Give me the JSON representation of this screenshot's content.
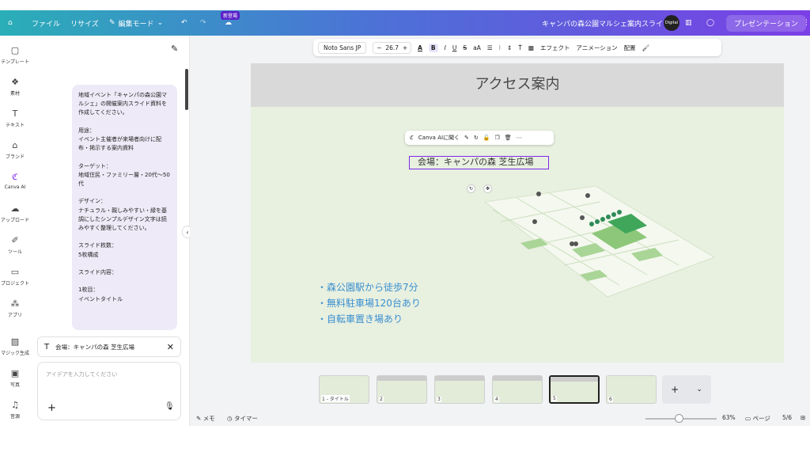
{
  "topbar": {
    "file": "ファイル",
    "resize": "リサイズ",
    "edit_mode": "編集モード",
    "new_badge": "新登場",
    "doc_title": "キャンパの森公園マルシェ案内スライド",
    "present": "プレゼンテーション"
  },
  "rail": [
    {
      "icon": "template-icon",
      "label": "テンプレート"
    },
    {
      "icon": "elements-icon",
      "label": "素材"
    },
    {
      "icon": "text-icon",
      "label": "テキスト"
    },
    {
      "icon": "brand-icon",
      "label": "ブランド"
    },
    {
      "icon": "canva-ai-icon",
      "label": "Canva AI"
    },
    {
      "icon": "upload-icon",
      "label": "アップロード"
    },
    {
      "icon": "tools-icon",
      "label": "ツール"
    },
    {
      "icon": "project-icon",
      "label": "プロジェクト"
    },
    {
      "icon": "apps-icon",
      "label": "アプリ"
    },
    {
      "icon": "magic-icon",
      "label": "マジック生成"
    },
    {
      "icon": "photo-icon",
      "label": "写真"
    },
    {
      "icon": "audio-icon",
      "label": "音源"
    }
  ],
  "chat": {
    "message": "地域イベント「キャンパの森公園マルシェ」の開催案内スライド資料を作成してください。\n\n用途：\nイベント主催者が来場者向けに配布・掲示する案内資料\n\nターゲット：\n地域住民・ファミリー層・20代〜50代\n\nデザイン：\nナチュラル・親しみやすい・緑を基調にしたシンプルデザイン文字は読みやすく整理してください。\n\nスライド枚数：\n5枚構成\n\nスライド内容：\n\n1枚目：\nイベントタイトル",
    "context_chip": "会場：キャンパの森 芝生広場",
    "input_placeholder": "アイデアを入力してください"
  },
  "toolbar": {
    "font": "Noto Sans JP",
    "minus": "−",
    "size": "26.7",
    "plus": "+",
    "case": "aA",
    "effects": "エフェクト",
    "animation": "アニメーション",
    "position": "配置"
  },
  "slide": {
    "title": "アクセス案内",
    "ai_label": "Canva AIに聞く",
    "venue": "会場：キャンパの森 芝生広場",
    "bullets": [
      "・森公園駅から徒歩7分",
      "・無料駐車場120台あり",
      "・自転車置き場あり"
    ]
  },
  "thumbnails": [
    {
      "num": "1 - タイトル"
    },
    {
      "num": "2"
    },
    {
      "num": "3"
    },
    {
      "num": "4"
    },
    {
      "num": "5"
    },
    {
      "num": "6"
    }
  ],
  "bottombar": {
    "notes": "メモ",
    "timer": "タイマー",
    "zoom": "63%",
    "pages": "ページ",
    "page_count": "5/6"
  },
  "colors": {
    "accent": "#7d2ae8",
    "bullet": "#3a8fd0",
    "slide_bg": "#e8f0e0"
  }
}
